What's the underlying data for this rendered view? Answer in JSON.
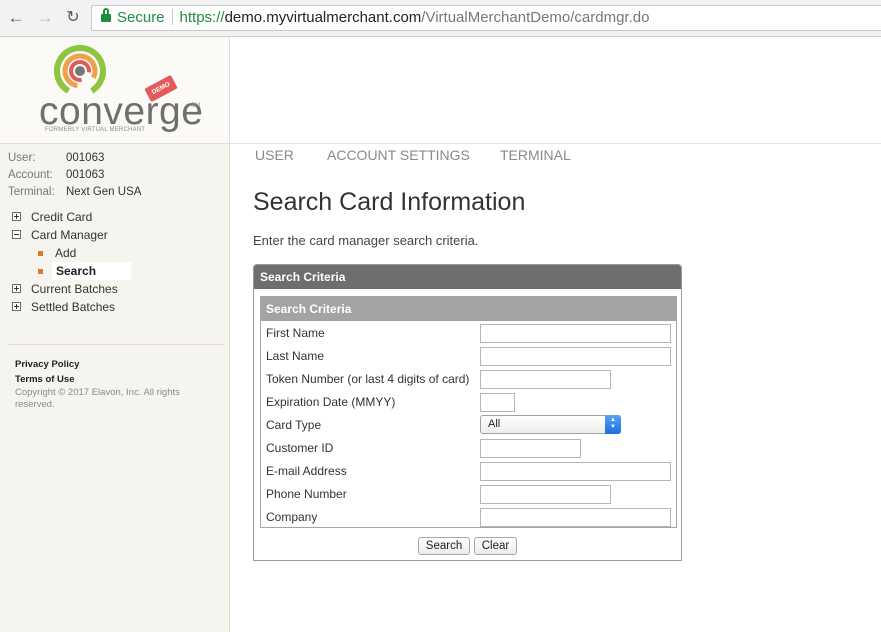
{
  "browser": {
    "secure_label": "Secure",
    "url_scheme": "https://",
    "url_host": "demo.myvirtualmerchant.com",
    "url_path": "/VirtualMerchantDemo/cardmgr.do",
    "back_icon": "arrow-left-icon",
    "forward_icon": "arrow-right-icon",
    "reload_icon": "reload-icon"
  },
  "logo": {
    "wordmark": "converge",
    "sm": "SM",
    "tagline": "FORMERLY VIRTUAL MERCHANT",
    "demo_badge": "DEMO",
    "ring_colors": [
      "#8cc63f",
      "#f0a04b",
      "#e35a5a",
      "#777777"
    ]
  },
  "user_info": [
    {
      "key": "User:",
      "value": "001063"
    },
    {
      "key": "Account:",
      "value": "001063"
    },
    {
      "key": "Terminal:",
      "value": "Next Gen USA"
    }
  ],
  "menu": {
    "credit_card": "Credit Card",
    "card_manager": "Card Manager",
    "card_manager_sub": [
      {
        "label": "Add"
      },
      {
        "label": "Search"
      }
    ],
    "current_batches": "Current Batches",
    "settled_batches": "Settled Batches"
  },
  "footer": {
    "privacy": "Privacy Policy",
    "terms": "Terms of Use",
    "copyright": "Copyright © 2017 Elavon, Inc. All rights reserved."
  },
  "topnav": {
    "user": "USER",
    "account_settings": "ACCOUNT SETTINGS",
    "terminal": "TERMINAL"
  },
  "page": {
    "title": "Search Card Information",
    "instructions": "Enter the card manager search criteria."
  },
  "form": {
    "panel_title": "Search Criteria",
    "section_title": "Search Criteria",
    "first_name_label": "First Name",
    "last_name_label": "Last Name",
    "token_label": "Token Number (or last 4 digits of card)",
    "expiration_label": "Expiration Date (MMYY)",
    "card_type_label": "Card Type",
    "card_type_value": "All",
    "customer_id_label": "Customer ID",
    "email_label": "E-mail Address",
    "phone_label": "Phone Number",
    "company_label": "Company",
    "search_button": "Search",
    "clear_button": "Clear"
  },
  "colors": {
    "accent_orange": "#e0782f",
    "secure_green": "#1e8e3e",
    "panel_header": "#6e6e6e",
    "section_header": "#a3a3a3"
  }
}
